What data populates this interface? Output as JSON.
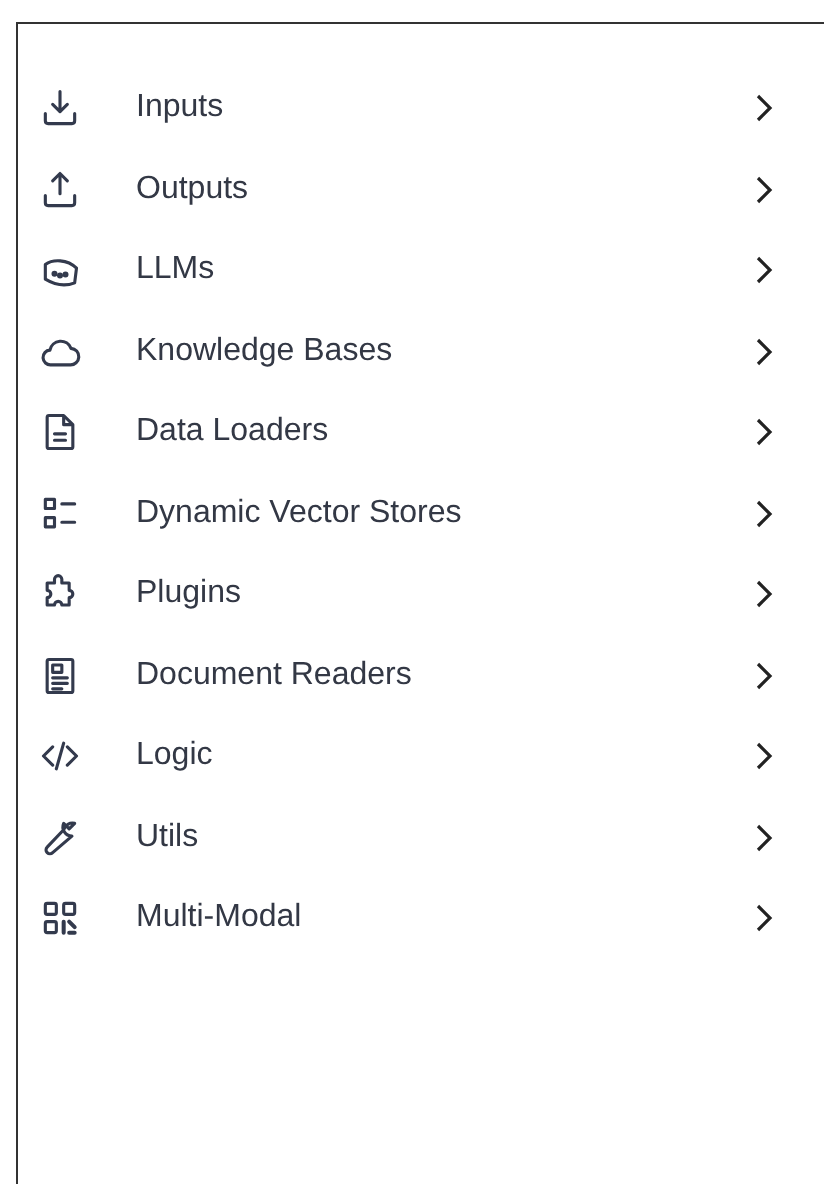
{
  "menu": {
    "items": [
      {
        "label": "Inputs"
      },
      {
        "label": "Outputs"
      },
      {
        "label": "LLMs"
      },
      {
        "label": "Knowledge Bases"
      },
      {
        "label": "Data Loaders"
      },
      {
        "label": "Dynamic Vector Stores"
      },
      {
        "label": "Plugins"
      },
      {
        "label": "Document Readers"
      },
      {
        "label": "Logic"
      },
      {
        "label": "Utils"
      },
      {
        "label": "Multi-Modal"
      }
    ]
  }
}
